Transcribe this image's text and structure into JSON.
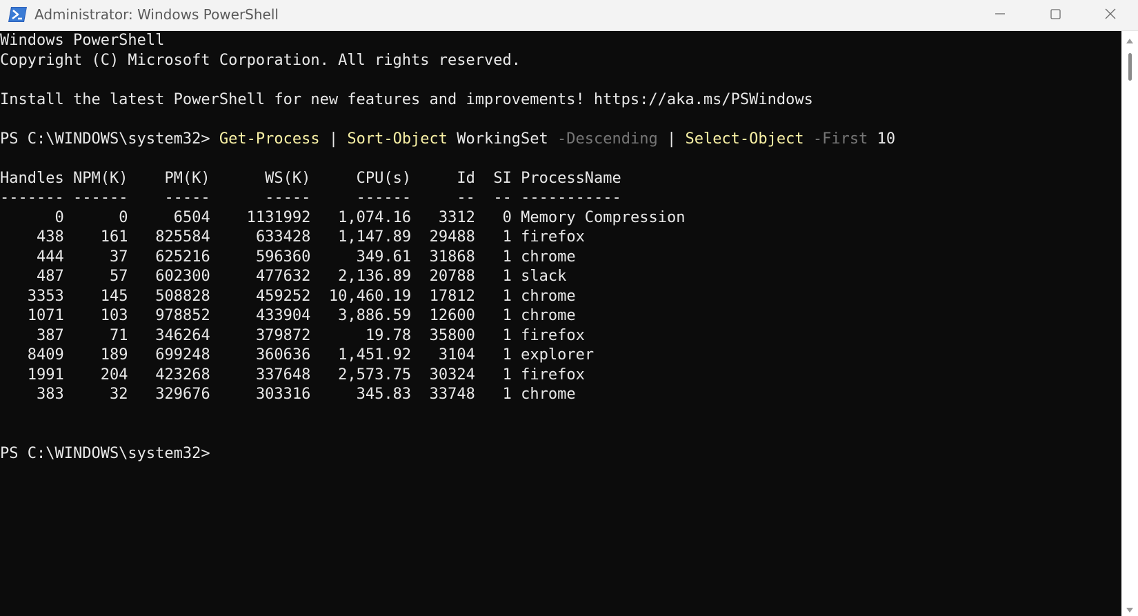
{
  "window": {
    "title": "Administrator: Windows PowerShell",
    "icon": "powershell-icon",
    "controls": [
      "minimize-icon",
      "maximize-icon",
      "close-icon"
    ]
  },
  "terminal": {
    "banner": [
      "Windows PowerShell",
      "Copyright (C) Microsoft Corporation. All rights reserved.",
      "",
      "Install the latest PowerShell for new features and improvements! https://aka.ms/PSWindows"
    ],
    "prompt": "PS C:\\WINDOWS\\system32> ",
    "command_tokens": [
      {
        "text": "Get-Process",
        "kind": "cmd"
      },
      {
        "text": " | ",
        "kind": "text"
      },
      {
        "text": "Sort-Object",
        "kind": "cmd"
      },
      {
        "text": " WorkingSet ",
        "kind": "text"
      },
      {
        "text": "-Descending",
        "kind": "param"
      },
      {
        "text": " | ",
        "kind": "text"
      },
      {
        "text": "Select-Object",
        "kind": "cmd"
      },
      {
        "text": " ",
        "kind": "text"
      },
      {
        "text": "-First",
        "kind": "param"
      },
      {
        "text": " 10",
        "kind": "num"
      }
    ],
    "table": {
      "headers": [
        "Handles",
        "NPM(K)",
        "PM(K)",
        "WS(K)",
        "CPU(s)",
        "Id",
        "SI",
        "ProcessName"
      ],
      "separators": [
        "-------",
        "------",
        "-----",
        "-----",
        "------",
        "--",
        "--",
        "-----------"
      ],
      "rows": [
        [
          "0",
          "0",
          "6504",
          "1131992",
          "1,074.16",
          "3312",
          "0",
          "Memory Compression"
        ],
        [
          "438",
          "161",
          "825584",
          "633428",
          "1,147.89",
          "29488",
          "1",
          "firefox"
        ],
        [
          "444",
          "37",
          "625216",
          "596360",
          "349.61",
          "31868",
          "1",
          "chrome"
        ],
        [
          "487",
          "57",
          "602300",
          "477632",
          "2,136.89",
          "20788",
          "1",
          "slack"
        ],
        [
          "3353",
          "145",
          "508828",
          "459252",
          "10,460.19",
          "17812",
          "1",
          "chrome"
        ],
        [
          "1071",
          "103",
          "978852",
          "433904",
          "3,886.59",
          "12600",
          "1",
          "chrome"
        ],
        [
          "387",
          "71",
          "346264",
          "379872",
          "19.78",
          "35800",
          "1",
          "firefox"
        ],
        [
          "8409",
          "189",
          "699248",
          "360636",
          "1,451.92",
          "3104",
          "1",
          "explorer"
        ],
        [
          "1991",
          "204",
          "423268",
          "337648",
          "2,573.75",
          "30324",
          "1",
          "firefox"
        ],
        [
          "383",
          "32",
          "329676",
          "303316",
          "345.83",
          "33748",
          "1",
          "chrome"
        ]
      ]
    },
    "final_prompt": "PS C:\\WINDOWS\\system32>"
  },
  "colors": {
    "background": "#0c0c0c",
    "foreground": "#e8e8e8",
    "command": "#f9f1a5",
    "parameter": "#767676"
  }
}
